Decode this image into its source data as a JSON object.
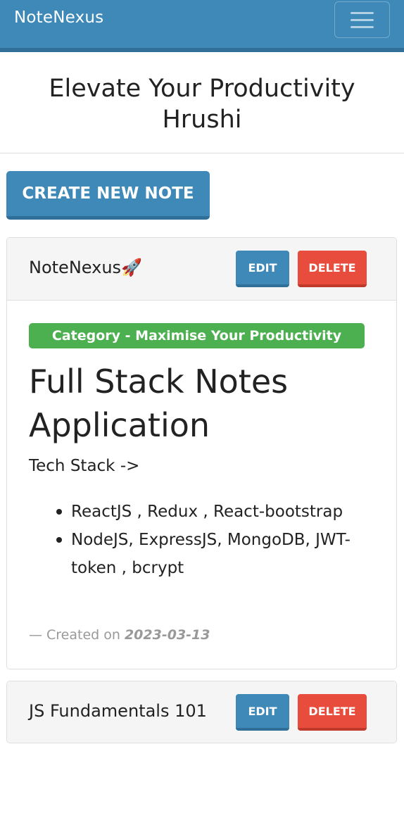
{
  "navbar": {
    "brand": "NoteNexus",
    "menu_icon": "hamburger-menu-icon"
  },
  "hero": {
    "line1": "Elevate Your Productivity",
    "line2": "Hrushi"
  },
  "actions": {
    "create_label": "Create New Note"
  },
  "notes": [
    {
      "title": "NoteNexus🚀",
      "edit_label": "Edit",
      "delete_label": "Delete",
      "category": "Category - Maximise Your Productivity",
      "heading": "Full Stack Notes Application",
      "subheading": "Tech Stack ->",
      "items": [
        "ReactJS , Redux , React-bootstrap",
        "NodeJS, ExpressJS, MongoDB, JWT-token , bcrypt"
      ],
      "created_prefix": "Created on",
      "created_date": "2023-03-13"
    },
    {
      "title": "JS Fundamentals 101",
      "edit_label": "Edit",
      "delete_label": "Delete"
    }
  ],
  "colors": {
    "primary": "#3e89b8",
    "danger": "#e74c3c",
    "success": "#4caf50"
  }
}
